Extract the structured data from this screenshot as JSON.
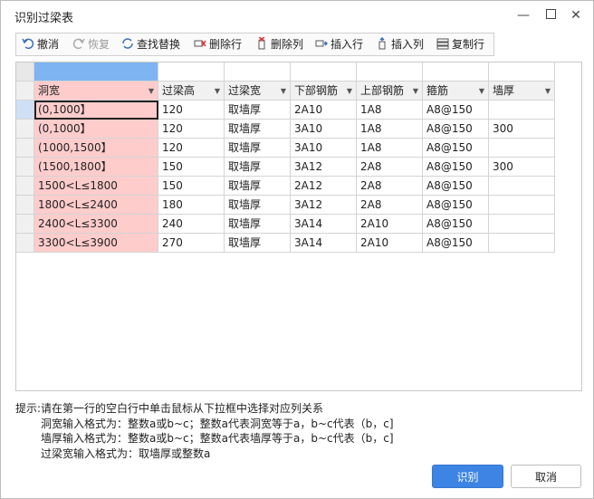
{
  "window": {
    "title": "识别过梁表"
  },
  "toolbar": {
    "undo": "撤消",
    "redo": "恢复",
    "find_replace": "查找替换",
    "delete_row": "删除行",
    "delete_col": "删除列",
    "insert_row": "插入行",
    "insert_col": "插入列",
    "copy_row": "复制行"
  },
  "table": {
    "headers": [
      "洞宽",
      "过梁高",
      "过梁宽",
      "下部钢筋",
      "上部钢筋",
      "箍筋",
      "墙厚"
    ],
    "rows": [
      [
        "(0,1000】",
        "120",
        "取墙厚",
        "2A10",
        "1A8",
        "A8@150",
        ""
      ],
      [
        "(0,1000】",
        "120",
        "取墙厚",
        "3A10",
        "1A8",
        "A8@150",
        "300"
      ],
      [
        "(1000,1500】",
        "120",
        "取墙厚",
        "3A10",
        "1A8",
        "A8@150",
        ""
      ],
      [
        "(1500,1800】",
        "150",
        "取墙厚",
        "3A12",
        "2A8",
        "A8@150",
        "300"
      ],
      [
        "1500<L≤1800",
        "150",
        "取墙厚",
        "2A12",
        "2A8",
        "A8@150",
        ""
      ],
      [
        "1800<L≤2400",
        "180",
        "取墙厚",
        "3A12",
        "2A8",
        "A8@150",
        ""
      ],
      [
        "2400<L≤3300",
        "240",
        "取墙厚",
        "3A14",
        "2A10",
        "A8@150",
        ""
      ],
      [
        "3300<L≤3900",
        "270",
        "取墙厚",
        "3A14",
        "2A10",
        "A8@150",
        ""
      ]
    ]
  },
  "hints": {
    "line1": "提示:请在第一行的空白行中单击鼠标从下拉框中选择对应列关系",
    "line2": "洞宽输入格式为：整数a或b~c；整数a代表洞宽等于a，b~c代表（b，c]",
    "line3": "墙厚输入格式为：整数a或b~c；整数a代表墙厚等于a，b~c代表（b，c]",
    "line4": "过梁宽输入格式为：取墙厚或整数a"
  },
  "buttons": {
    "ok": "识别",
    "cancel": "取消"
  },
  "colors": {
    "accent": "#3d84e4",
    "highlight": "#ffcccc",
    "header_blank": "#7eb4f2"
  }
}
